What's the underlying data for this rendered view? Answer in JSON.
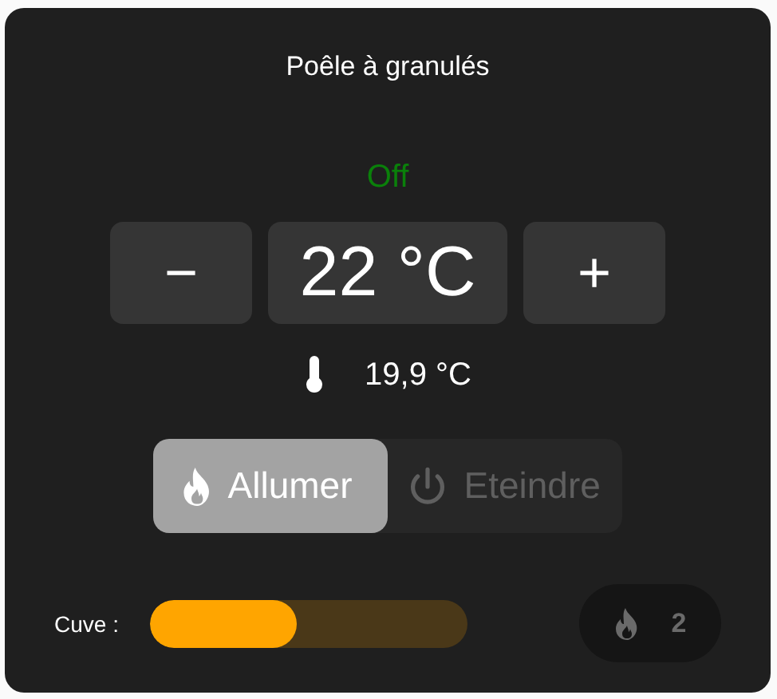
{
  "title": "Poêle à granulés",
  "status": {
    "text": "Off",
    "color": "#0a800a"
  },
  "setpoint": {
    "decrease": "−",
    "value": "22 °C",
    "increase": "+"
  },
  "current_temperature": "19,9 °C",
  "modes": [
    {
      "label": "Allumer",
      "kind": "flame",
      "selected": true
    },
    {
      "label": "Eteindre",
      "kind": "power",
      "selected": false
    }
  ],
  "tank": {
    "label": "Cuve :",
    "level": 0.46
  },
  "power": {
    "value": "2"
  }
}
